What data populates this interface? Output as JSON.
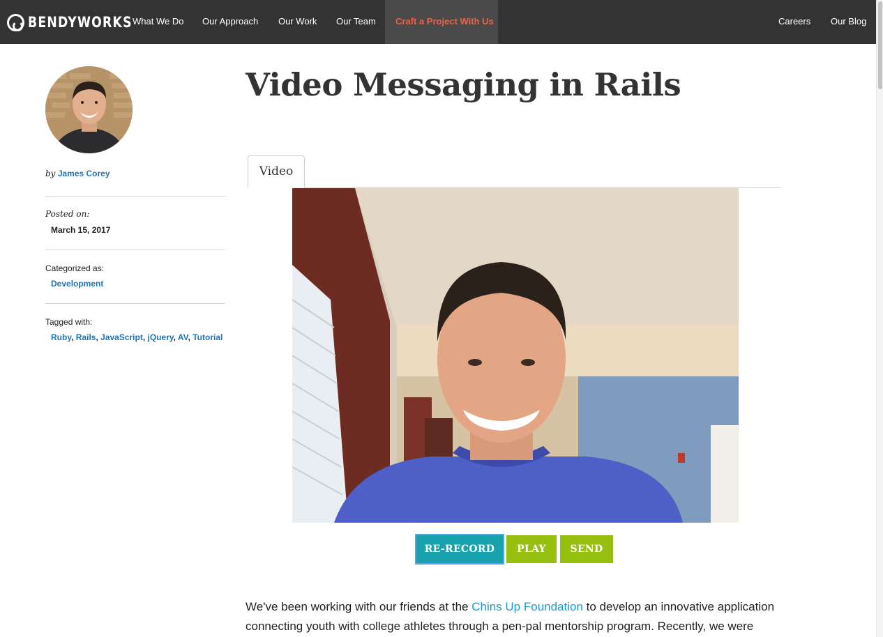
{
  "nav": {
    "logo_text": "BENDYWORKS",
    "items": [
      "What We Do",
      "Our Approach",
      "Our Work",
      "Our Team"
    ],
    "cta": "Craft a Project With Us",
    "right_items": [
      "Careers",
      "Our Blog"
    ]
  },
  "sidebar": {
    "by": "by",
    "author": "James Corey",
    "posted_label": "Posted on:",
    "posted_date": "March 15, 2017",
    "categorized_label": "Categorized as:",
    "category": "Development",
    "tagged_label": "Tagged with:",
    "tags": [
      "Ruby",
      "Rails",
      "JavaScript",
      "jQuery",
      "AV",
      "Tutorial"
    ]
  },
  "main": {
    "title": "Video Messaging in Rails",
    "tab": "Video",
    "buttons": {
      "rerecord": "RE-RECORD",
      "play": "PLAY",
      "send": "SEND"
    },
    "body_intro": "We've been working with our friends at the ",
    "body_link": "Chins Up Foundation",
    "body_rest": " to develop an innovative application connecting youth with college athletes through a pen-pal mentorship program. Recently, we were"
  },
  "colors": {
    "nav_bg": "#333333",
    "cta_text": "#e8634a",
    "link": "#1f74b8",
    "rerecord_button": "#17a2ad",
    "play_send_button": "#96bf10"
  }
}
